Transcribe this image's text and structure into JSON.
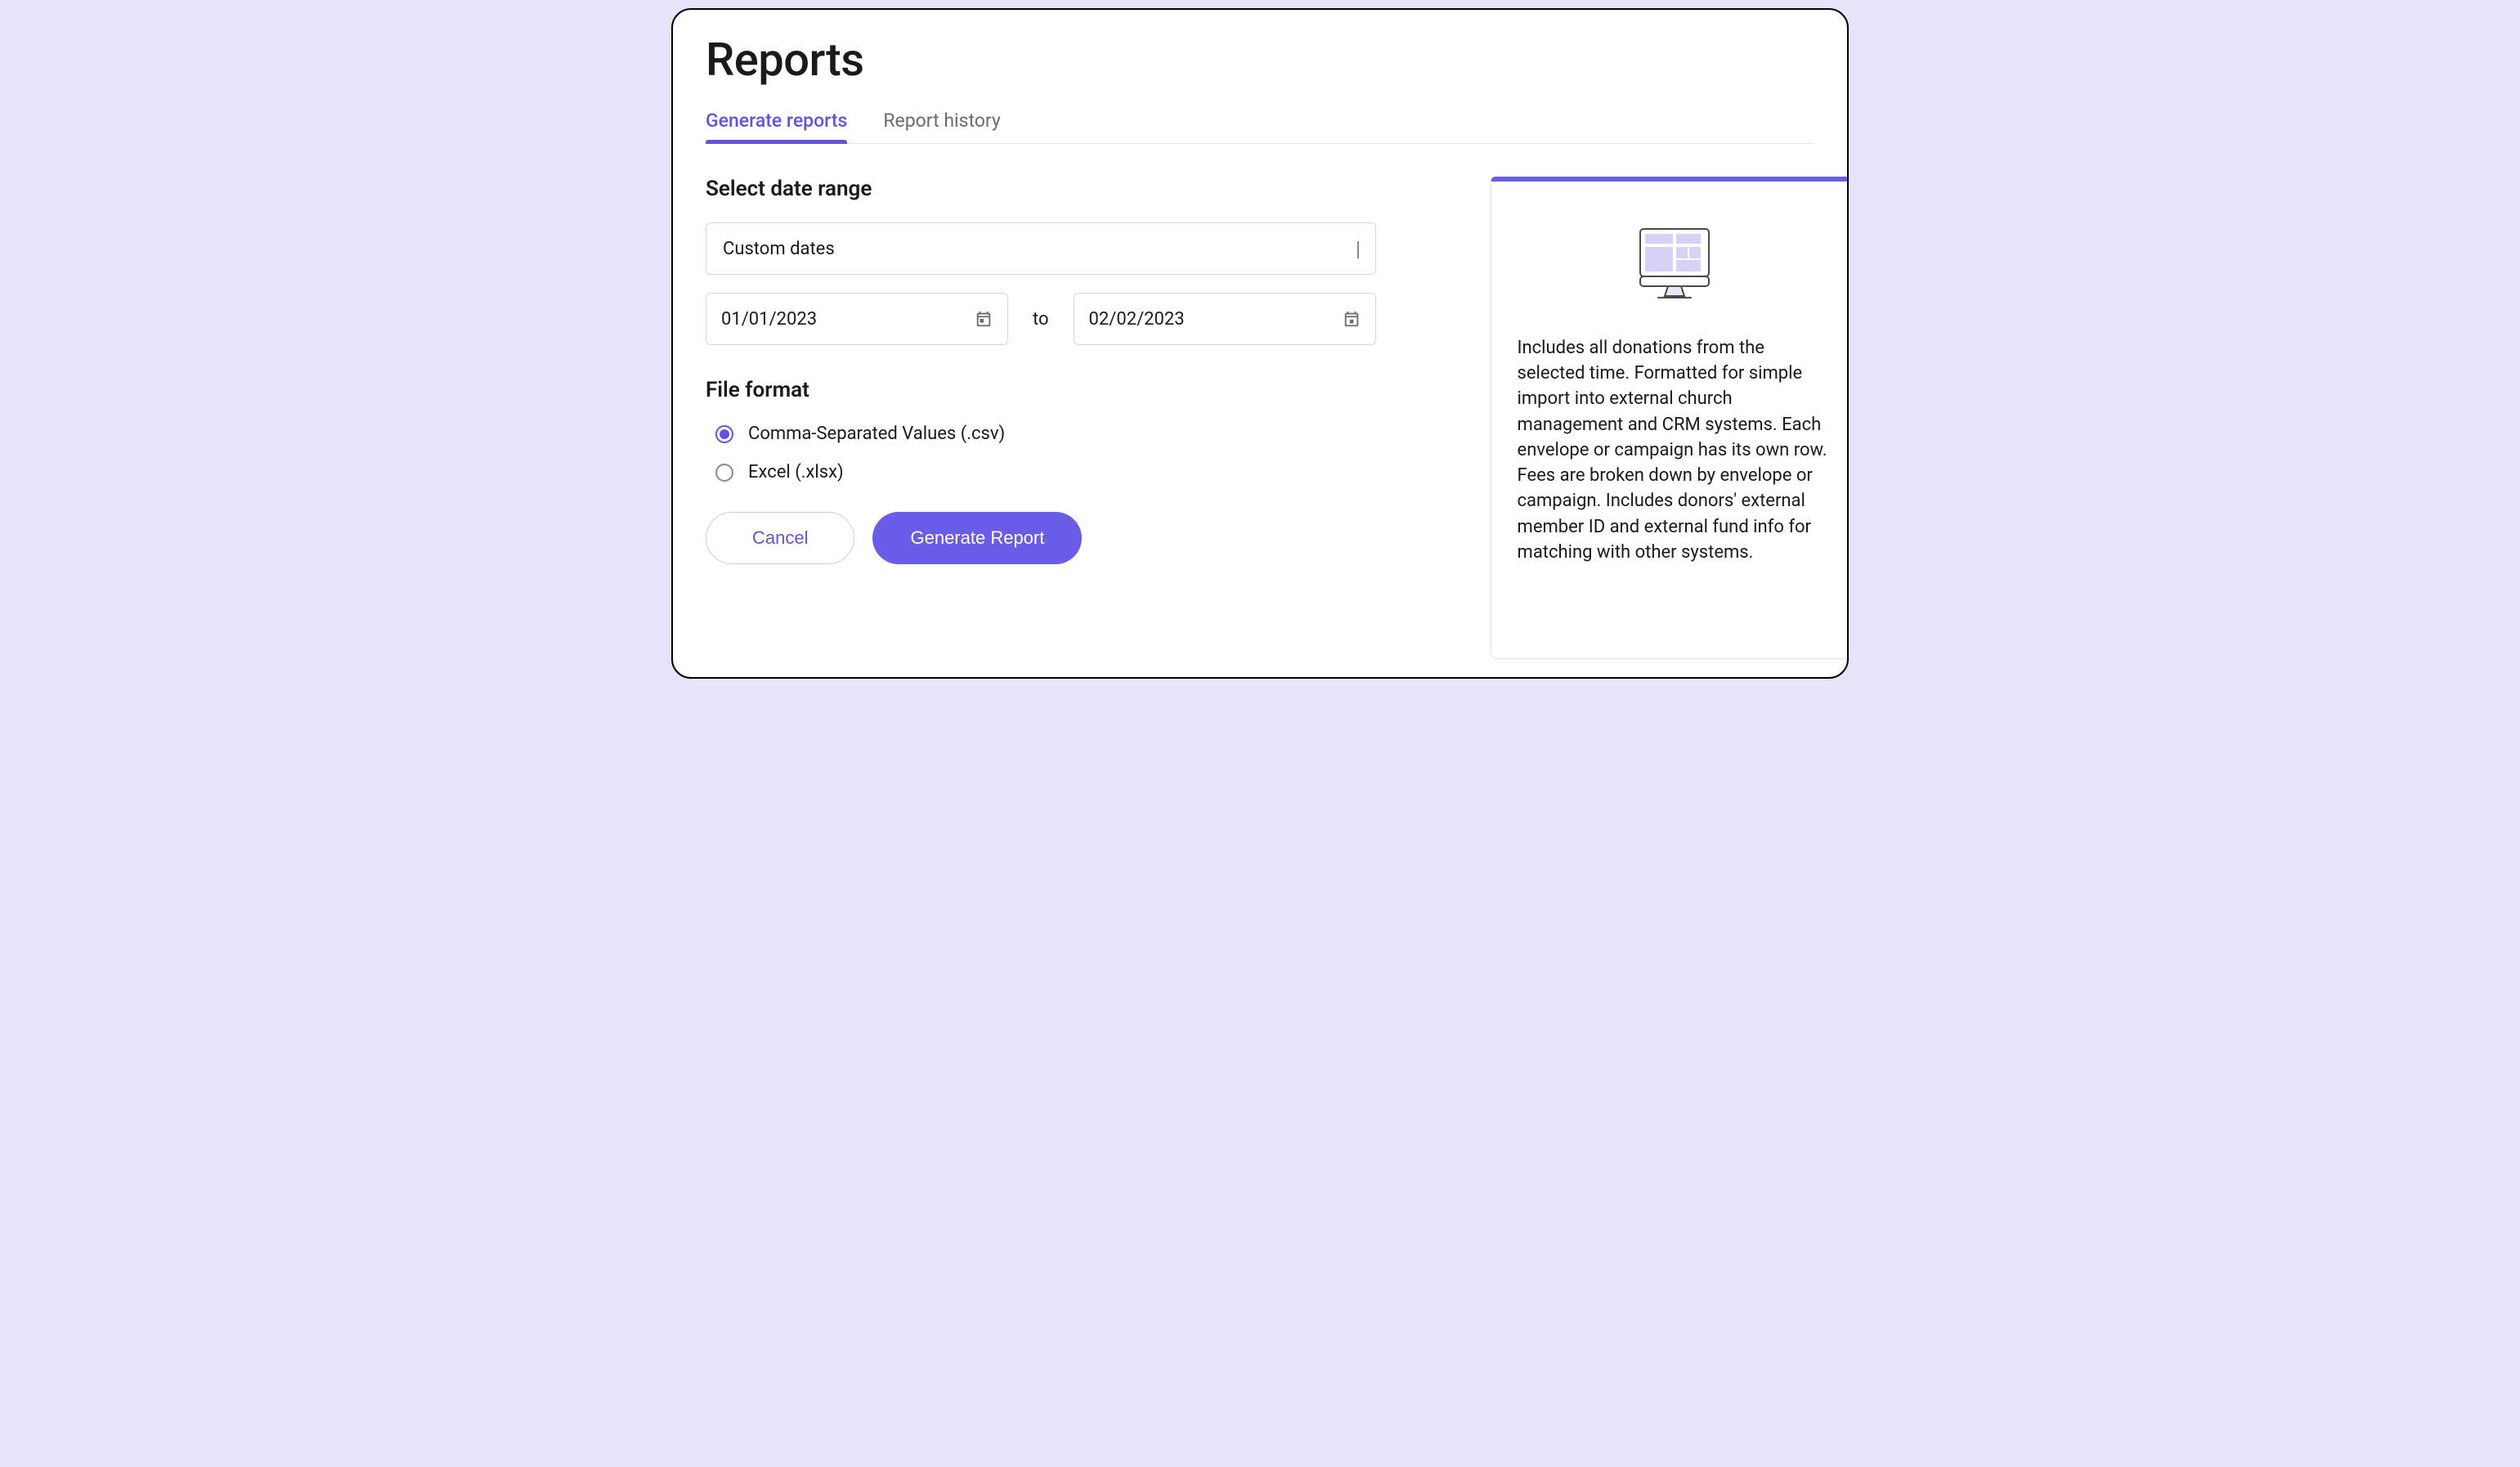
{
  "page": {
    "title": "Reports"
  },
  "tabs": {
    "generate": "Generate reports",
    "history": "Report history"
  },
  "headings": {
    "date_range": "Select date range",
    "file_format": "File format"
  },
  "date_select": {
    "selected": "Custom dates"
  },
  "dates": {
    "from": "01/01/2023",
    "to_label": "to",
    "to": "02/02/2023"
  },
  "format_options": {
    "csv": "Comma-Separated Values (.csv)",
    "xlsx": "Excel (.xlsx)"
  },
  "buttons": {
    "cancel": "Cancel",
    "generate": "Generate Report"
  },
  "info": {
    "description": "Includes all donations from the selected time. Formatted for simple import into external church management and CRM systems. Each envelope or campaign has its own row. Fees are broken down by envelope or campaign. Includes donors' external member ID and external fund info for matching with other systems."
  }
}
